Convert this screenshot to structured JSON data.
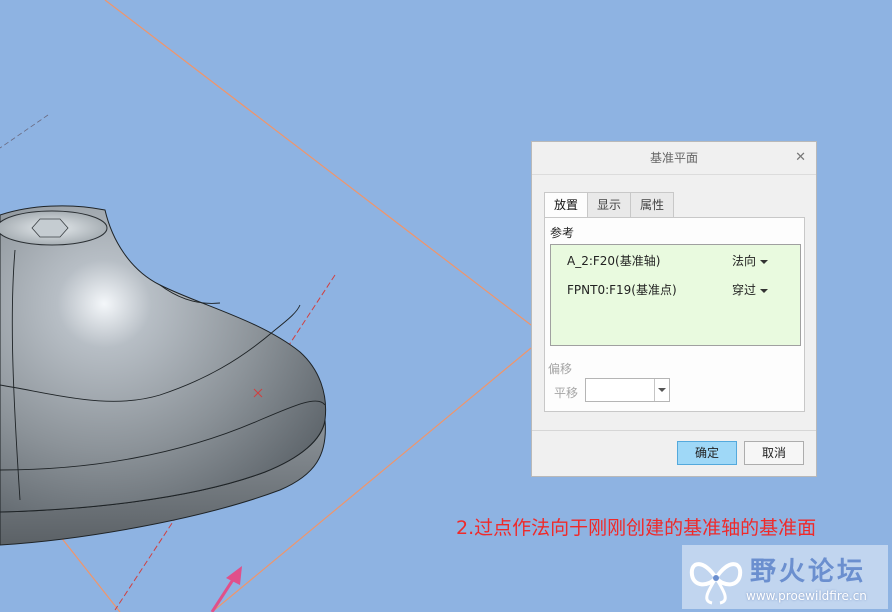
{
  "dialog": {
    "title": "基准平面",
    "close_glyph": "✕",
    "tabs": [
      {
        "label": "放置",
        "active": true
      },
      {
        "label": "显示",
        "active": false
      },
      {
        "label": "属性",
        "active": false
      }
    ],
    "references_label": "参考",
    "references": [
      {
        "name": "A_2:F20(基准轴)",
        "constraint": "法向"
      },
      {
        "name": "FPNT0:F19(基准点)",
        "constraint": "穿过"
      }
    ],
    "offset_label": "偏移",
    "translation_label": "平移",
    "translation_value": "",
    "ok_label": "确定",
    "cancel_label": "取消"
  },
  "annotation": "2.过点作法向于刚刚创建的基准轴的基准面",
  "watermark": {
    "title": "野火论坛",
    "url": "www.proewildfire.cn"
  },
  "colors": {
    "background": "#8eb3e2",
    "model_surface": "#8c9399",
    "datum_plane_edge": "#f0956a",
    "datum_axis": "#d04040",
    "annotation": "#ef2a2a",
    "ok_button": "#9fd8f7",
    "reference_box": "#e9fadf"
  },
  "icons": [
    "close-icon",
    "dropdown-caret-icon",
    "watermark-logo-icon"
  ]
}
